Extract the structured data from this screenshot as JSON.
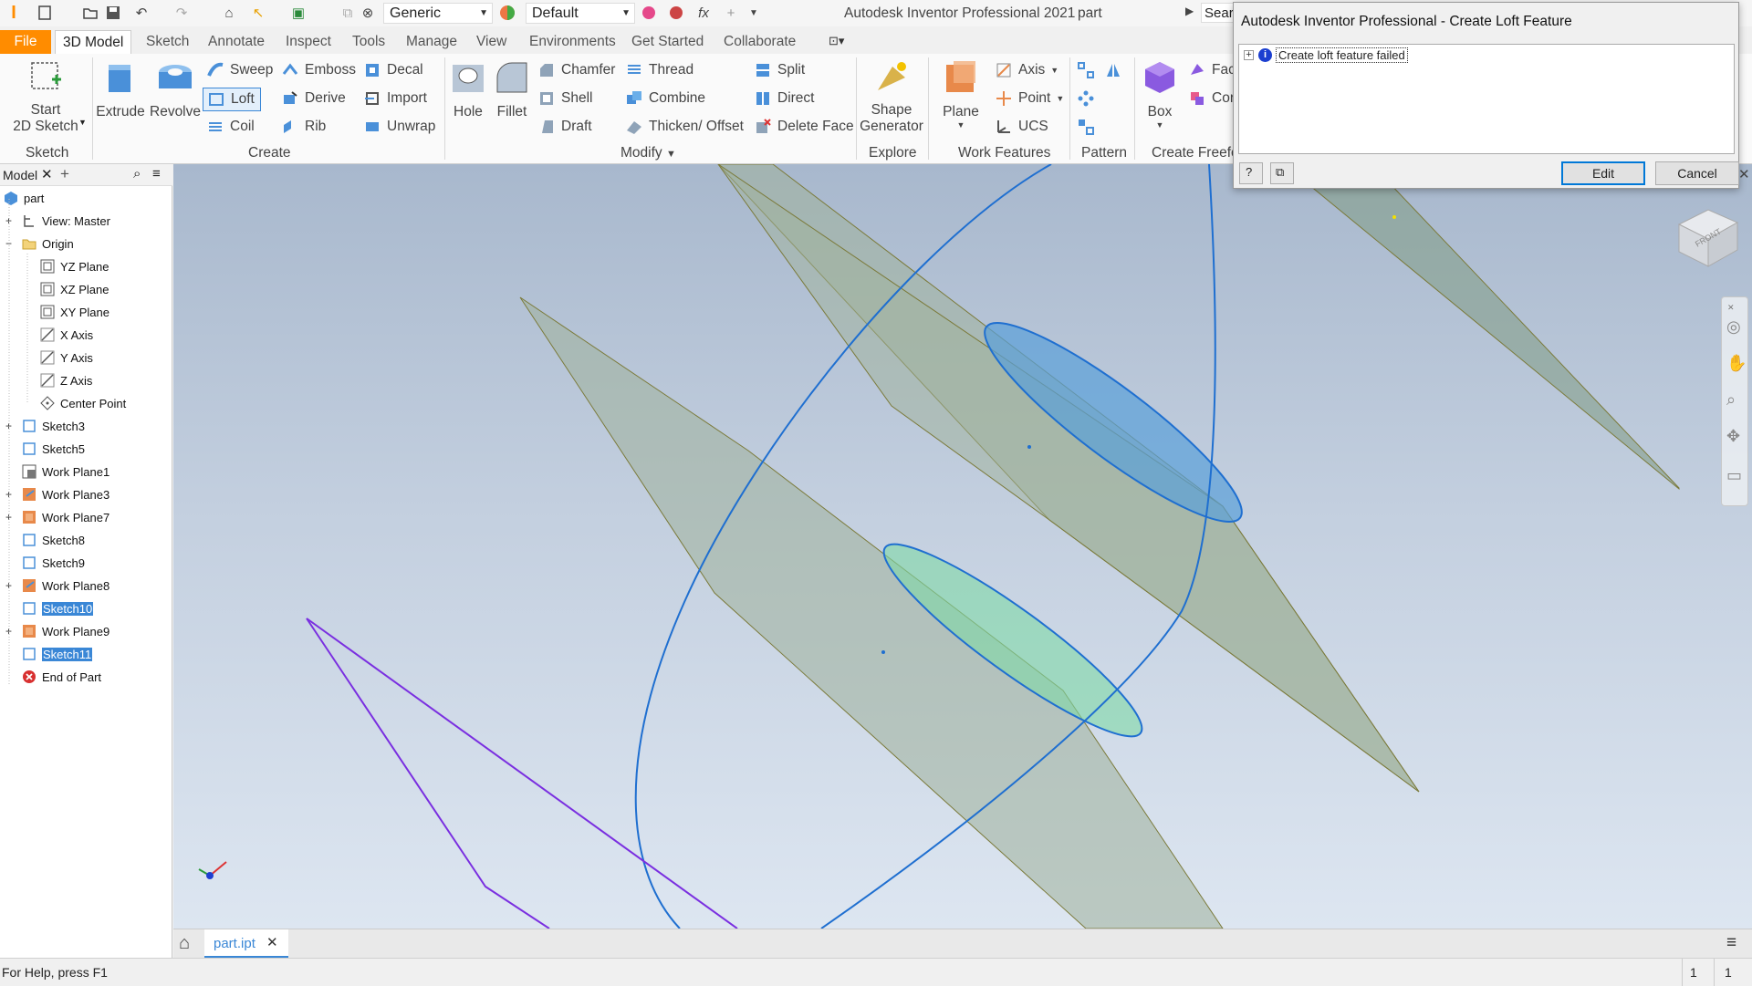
{
  "app": {
    "title": "Autodesk Inventor Professional 2021",
    "document": "part",
    "search_placeholder": "Sear"
  },
  "qat": {
    "material_value": "Generic",
    "appearance_value": "Default",
    "fx_label": "fx"
  },
  "tabs": [
    "File",
    "3D Model",
    "Sketch",
    "Annotate",
    "Inspect",
    "Tools",
    "Manage",
    "View",
    "Environments",
    "Get Started",
    "Collaborate"
  ],
  "ribbon": {
    "sketch": {
      "start_label_1": "Start",
      "start_label_2": "2D Sketch",
      "group": "Sketch"
    },
    "create": {
      "extrude": "Extrude",
      "revolve": "Revolve",
      "sweep": "Sweep",
      "loft": "Loft",
      "coil": "Coil",
      "emboss": "Emboss",
      "derive": "Derive",
      "rib": "Rib",
      "decal": "Decal",
      "import": "Import",
      "unwrap": "Unwrap",
      "group": "Create"
    },
    "modify": {
      "hole": "Hole",
      "fillet": "Fillet",
      "chamfer": "Chamfer",
      "shell": "Shell",
      "draft": "Draft",
      "thread": "Thread",
      "combine": "Combine",
      "thicken": "Thicken/ Offset",
      "split": "Split",
      "direct": "Direct",
      "delete_face": "Delete Face",
      "group": "Modify"
    },
    "explore": {
      "shape_1": "Shape",
      "shape_2": "Generator",
      "group": "Explore"
    },
    "work_features": {
      "plane": "Plane",
      "axis": "Axis",
      "point": "Point",
      "ucs": "UCS",
      "group": "Work Features"
    },
    "pattern": {
      "group": "Pattern"
    },
    "freeform": {
      "box": "Box",
      "face": "Fac",
      "con": "Cor",
      "group": "Create Freefo"
    }
  },
  "browser": {
    "tab_label": "Model",
    "items": [
      {
        "label": "part",
        "icon": "part-icon"
      },
      {
        "label": "View: Master",
        "icon": "view-icon"
      },
      {
        "label": "Origin",
        "icon": "folder-icon"
      },
      {
        "label": "YZ Plane",
        "icon": "plane-icon"
      },
      {
        "label": "XZ Plane",
        "icon": "plane-icon"
      },
      {
        "label": "XY Plane",
        "icon": "plane-icon"
      },
      {
        "label": "X Axis",
        "icon": "axis-icon"
      },
      {
        "label": "Y Axis",
        "icon": "axis-icon"
      },
      {
        "label": "Z Axis",
        "icon": "axis-icon"
      },
      {
        "label": "Center Point",
        "icon": "point-icon"
      },
      {
        "label": "Sketch3",
        "icon": "sketch-icon"
      },
      {
        "label": "Sketch5",
        "icon": "sketch-icon"
      },
      {
        "label": "Work Plane1",
        "icon": "work-plane-icon"
      },
      {
        "label": "Work Plane3",
        "icon": "work-plane-icon"
      },
      {
        "label": "Work Plane7",
        "icon": "work-plane-icon"
      },
      {
        "label": "Sketch8",
        "icon": "sketch-icon"
      },
      {
        "label": "Sketch9",
        "icon": "sketch-icon"
      },
      {
        "label": "Work Plane8",
        "icon": "work-plane-icon"
      },
      {
        "label": "Sketch10",
        "icon": "sketch-icon"
      },
      {
        "label": "Work Plane9",
        "icon": "work-plane-icon"
      },
      {
        "label": "Sketch11",
        "icon": "sketch-icon"
      },
      {
        "label": "End of Part",
        "icon": "end-of-part-icon"
      }
    ]
  },
  "doc_tab": {
    "label": "part.ipt"
  },
  "status": {
    "help": "For Help, press F1",
    "count_1": "1",
    "count_2": "1"
  },
  "dialog": {
    "title": "Autodesk Inventor Professional - Create Loft Feature",
    "message": "Create loft feature failed",
    "edit": "Edit",
    "cancel": "Cancel"
  },
  "viewcube": {
    "face": "FRONT"
  }
}
